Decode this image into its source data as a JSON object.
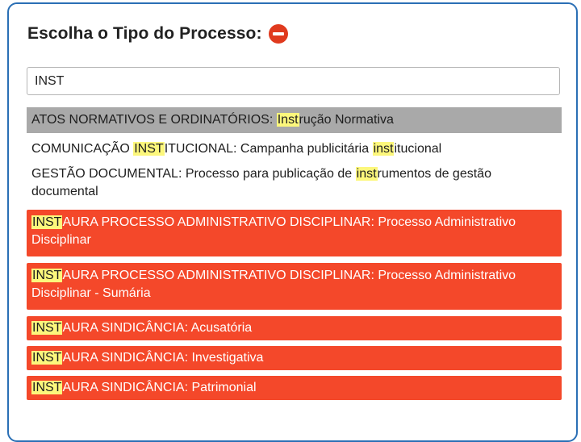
{
  "header": {
    "title": "Escolha o Tipo do Processo:",
    "remove_icon": "minus-circle-icon"
  },
  "search": {
    "value": "INST"
  },
  "results": [
    {
      "pre": "ATOS NORMATIVOS E ORDINATÓRIOS: ",
      "hl": "Inst",
      "post": "rução Normativa",
      "state": "selected"
    },
    {
      "pre": "COMUNICAÇÃO ",
      "hl": "INST",
      "mid": "ITUCIONAL: Campanha publicitária ",
      "hl2": "inst",
      "post": "itucional",
      "state": "normal"
    },
    {
      "pre": "GESTÃO DOCUMENTAL: Processo para publicação de ",
      "hl": "inst",
      "post": "rumentos de gestão documental",
      "state": "normal"
    },
    {
      "pre": "",
      "hl": "INST",
      "post": "AURA PROCESSO ADMINISTRATIVO DISCIPLINAR: Processo Administrativo Disciplinar",
      "state": "restricted"
    },
    {
      "pre": "",
      "hl": "INST",
      "post": "AURA PROCESSO ADMINISTRATIVO DISCIPLINAR: Processo Administrativo Disciplinar - Sumária",
      "state": "restricted"
    },
    {
      "pre": "",
      "hl": "INST",
      "post": "AURA SINDICÂNCIA: Acusatória",
      "state": "restricted"
    },
    {
      "pre": "",
      "hl": "INST",
      "post": "AURA SINDICÂNCIA: Investigativa",
      "state": "restricted"
    },
    {
      "pre": "",
      "hl": "INST",
      "post": "AURA SINDICÂNCIA: Patrimonial",
      "state": "restricted"
    }
  ],
  "colors": {
    "frame": "#2a6fb5",
    "selected": "#a9a9a9",
    "restricted": "#f4482a",
    "highlight": "#fcf77c",
    "remove_icon": "#e03a1e"
  }
}
